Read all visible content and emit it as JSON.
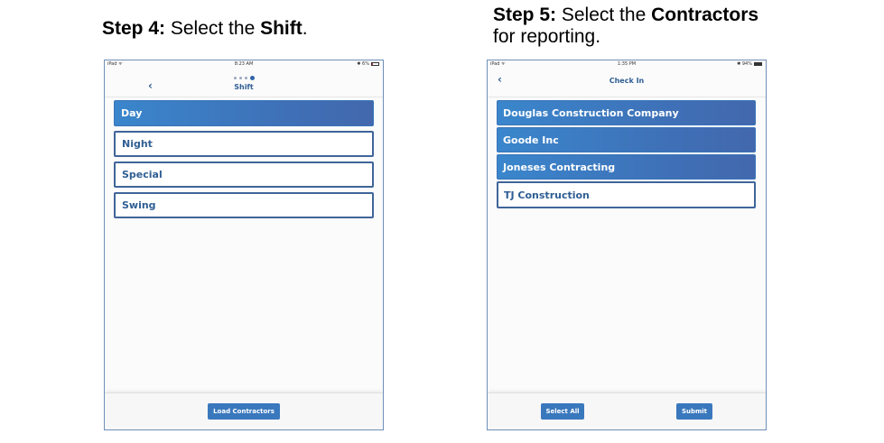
{
  "captions": {
    "step4": {
      "prefix": "Step 4:",
      "mid": " Select the ",
      "bold": "Shift",
      "suffix": "."
    },
    "step5": {
      "prefix": "Step 5:",
      "mid": " Select the ",
      "bold": "Contractors",
      "line2": "for reporting."
    }
  },
  "screen4": {
    "status": {
      "left": "iPad ᯤ",
      "time": "8:23 AM",
      "right": "✱ 6%",
      "battery_fraction": 0.06
    },
    "progress": {
      "total": 4,
      "current": 4
    },
    "back_icon": "‹",
    "title": "Shift",
    "items": [
      {
        "label": "Day",
        "selected": true
      },
      {
        "label": "Night",
        "selected": false
      },
      {
        "label": "Special",
        "selected": false
      },
      {
        "label": "Swing",
        "selected": false
      }
    ],
    "footer_button": "Load Contractors"
  },
  "screen5": {
    "status": {
      "left": "iPad ᯤ",
      "time": "1:35 PM",
      "right": "✱ 94%",
      "battery_fraction": 0.94
    },
    "back_icon": "‹",
    "title": "Check In",
    "items": [
      {
        "label": "Douglas Construction Company",
        "selected": true
      },
      {
        "label": "Goode Inc",
        "selected": true
      },
      {
        "label": "Joneses Contracting",
        "selected": true
      },
      {
        "label": "TJ Construction",
        "selected": false
      }
    ],
    "buttons": {
      "select_all": "Select All",
      "submit": "Submit"
    }
  },
  "colors": {
    "accent": "#3a78bd",
    "text_blue": "#2f5e93",
    "selected_gradient_start": "#3a86cc",
    "selected_gradient_end": "#4368ad"
  }
}
